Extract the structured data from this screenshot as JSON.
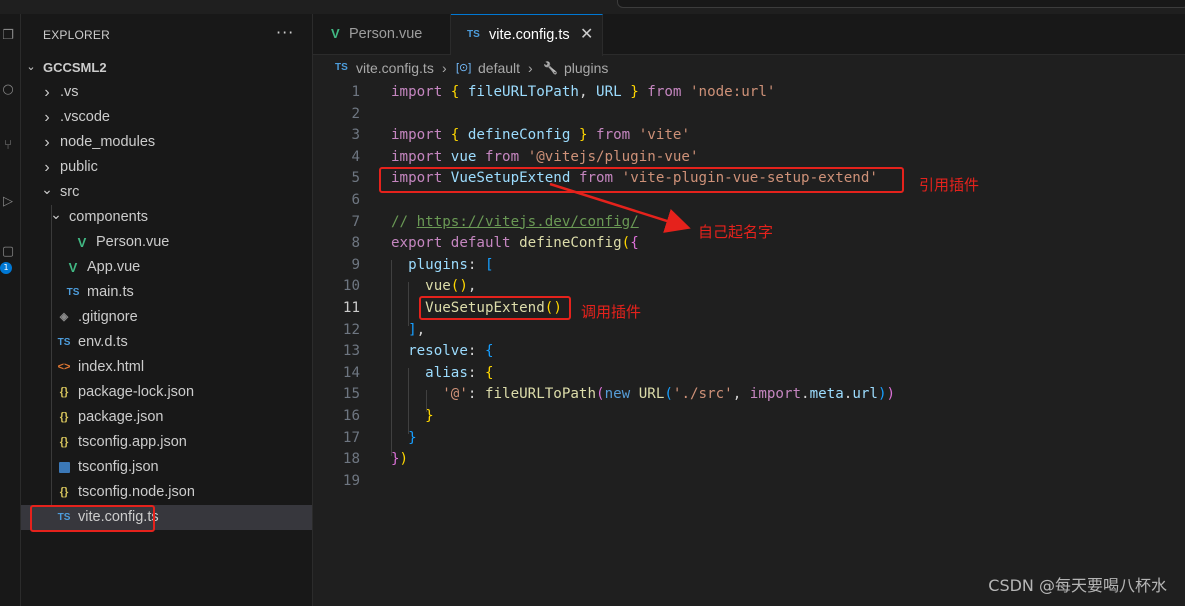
{
  "explorer": {
    "title": "EXPLORER",
    "more": "···",
    "root": "GCCSML2",
    "items": [
      {
        "label": ".vs",
        "kind": "folder",
        "icon": "chevron-right-icon",
        "chev": "›"
      },
      {
        "label": ".vscode",
        "kind": "folder",
        "icon": "chevron-right-icon",
        "chev": "›"
      },
      {
        "label": "node_modules",
        "kind": "folder",
        "icon": "chevron-right-icon",
        "chev": "›"
      },
      {
        "label": "public",
        "kind": "folder",
        "icon": "chevron-right-icon",
        "chev": "›"
      },
      {
        "label": "src",
        "kind": "folder",
        "icon": "chevron-down-icon",
        "chev": "⌄"
      },
      {
        "label": "components",
        "kind": "folder",
        "icon": "chevron-down-icon",
        "chev": "⌄"
      },
      {
        "label": "Person.vue",
        "kind": "file",
        "icon": "vue-file-icon",
        "glyph": "V"
      },
      {
        "label": "App.vue",
        "kind": "file",
        "icon": "vue-file-icon",
        "glyph": "V"
      },
      {
        "label": "main.ts",
        "kind": "file",
        "icon": "ts-file-icon",
        "glyph": "TS"
      },
      {
        "label": ".gitignore",
        "kind": "file",
        "icon": "git-file-icon",
        "glyph": "◈"
      },
      {
        "label": "env.d.ts",
        "kind": "file",
        "icon": "ts-file-icon",
        "glyph": "TS"
      },
      {
        "label": "index.html",
        "kind": "file",
        "icon": "html-file-icon",
        "glyph": "<>"
      },
      {
        "label": "package-lock.json",
        "kind": "file",
        "icon": "json-file-icon",
        "glyph": "{}"
      },
      {
        "label": "package.json",
        "kind": "file",
        "icon": "json-file-icon",
        "glyph": "{}"
      },
      {
        "label": "tsconfig.app.json",
        "kind": "file",
        "icon": "json-file-icon",
        "glyph": "{}"
      },
      {
        "label": "tsconfig.json",
        "kind": "file",
        "icon": "tsconfig-file-icon",
        "glyph": ""
      },
      {
        "label": "tsconfig.node.json",
        "kind": "file",
        "icon": "json-file-icon",
        "glyph": "{}"
      },
      {
        "label": "vite.config.ts",
        "kind": "file",
        "icon": "ts-file-icon",
        "glyph": "TS",
        "selected": true
      }
    ]
  },
  "tabs": [
    {
      "label": "Person.vue",
      "icon_glyph": "V",
      "active": false
    },
    {
      "label": "vite.config.ts",
      "icon_glyph": "TS",
      "active": true,
      "close": "✕"
    }
  ],
  "breadcrumb": {
    "file_icon": "TS",
    "file": "vite.config.ts",
    "sep": "›",
    "symbol_icon": "[⊙]",
    "symbol": "default",
    "prop_icon": "🔧",
    "prop": "plugins"
  },
  "code": {
    "current_line": 11,
    "lines": [
      "import { fileURLToPath, URL } from 'node:url'",
      "",
      "import { defineConfig } from 'vite'",
      "import vue from '@vitejs/plugin-vue'",
      "import VueSetupExtend from 'vite-plugin-vue-setup-extend'",
      "",
      "// https://vitejs.dev/config/",
      "export default defineConfig({",
      "  plugins: [",
      "    vue(),",
      "    VueSetupExtend()",
      "  ],",
      "  resolve: {",
      "    alias: {",
      "      '@': fileURLToPath(new URL('./src', import.meta.url))",
      "    }",
      "  }",
      "})",
      ""
    ]
  },
  "annotations": {
    "import_plugin": "引用插件",
    "custom_name": "自己起名字",
    "call_plugin": "调用插件"
  },
  "watermark": "CSDN @每天要喝八杯水",
  "colors": {
    "accent": "#0078d4",
    "annotation_red": "#e5221c",
    "vue_green": "#41b883",
    "ts_blue": "#4d9ddc"
  }
}
